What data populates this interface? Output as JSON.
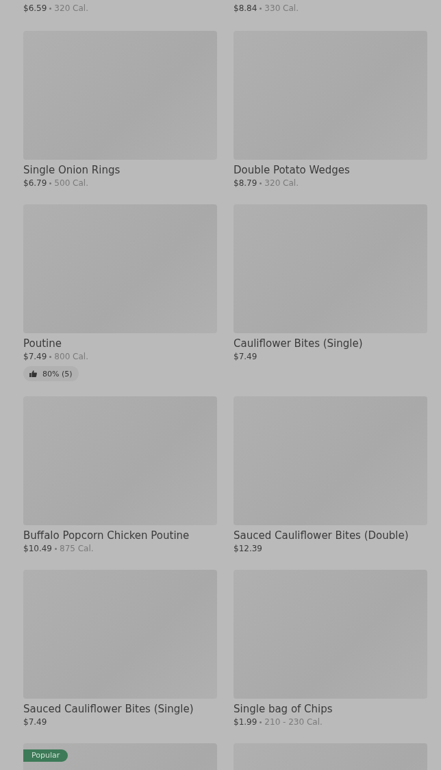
{
  "top_items": [
    {
      "price": "$6.59",
      "calories": "320 Cal."
    },
    {
      "price": "$8.84",
      "calories": "330 Cal."
    }
  ],
  "items": [
    {
      "title": "Single Onion Rings",
      "price": "$6.79",
      "calories": "500 Cal."
    },
    {
      "title": "Double Potato Wedges",
      "price": "$8.79",
      "calories": "320 Cal."
    },
    {
      "title": "Poutine",
      "price": "$7.49",
      "calories": "800 Cal.",
      "rating": "80% (5)"
    },
    {
      "title": "Cauliflower Bites (Single)",
      "price": "$7.49"
    },
    {
      "title": "Buffalo Popcorn Chicken Poutine",
      "price": "$10.49",
      "calories": "875 Cal."
    },
    {
      "title": "Sauced Cauliflower Bites (Double)",
      "price": "$12.39"
    },
    {
      "title": "Sauced Cauliflower Bites (Single)",
      "price": "$7.49"
    },
    {
      "title": "Single bag of Chips",
      "price": "$1.99",
      "calories": "210 - 230 Cal."
    }
  ],
  "bottom_items": [
    {
      "kind": "badged",
      "badge": "Popular"
    },
    {
      "kind": "plain"
    }
  ]
}
